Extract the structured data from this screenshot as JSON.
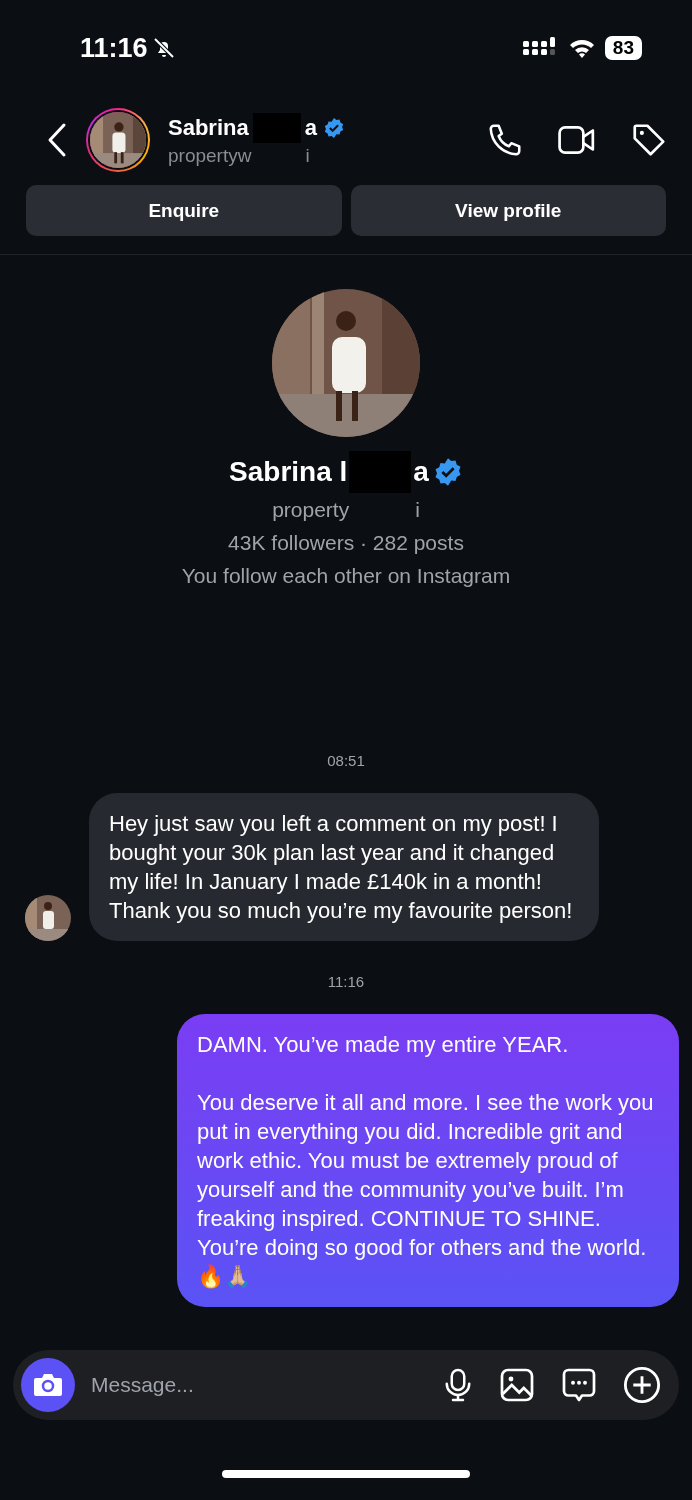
{
  "status_bar": {
    "time": "11:16",
    "silenced": true,
    "battery": "83"
  },
  "header": {
    "name": [
      "Sabrina",
      "a"
    ],
    "handle": [
      "propertyw",
      "i"
    ],
    "verified": true
  },
  "actions": [
    "Enquire",
    "View profile"
  ],
  "profile": {
    "name": [
      "Sabrina l",
      "a"
    ],
    "handle": [
      "property",
      "i"
    ],
    "verified": true,
    "stats": "43K followers · 282 posts",
    "mutual": "You follow each other on Instagram"
  },
  "messages": [
    {
      "kind": "time",
      "text": "08:51"
    },
    {
      "kind": "incoming",
      "paragraphs": [
        "Hey just saw you left a comment on my post! I bought your 30k plan last year and it changed my life! In January I made £140k in a month! Thank you so much you’re my favourite person!"
      ]
    },
    {
      "kind": "time",
      "text": "11:16"
    },
    {
      "kind": "outgoing",
      "paragraphs": [
        "DAMN. You’ve made my entire YEAR.",
        "You deserve it all and more. I see the work you put in everything you did. Incredible grit and work ethic. You must be extremely proud of yourself and the community you’ve built. I’m freaking inspired. CONTINUE TO SHINE. You’re doing so good for others and the world. 🔥🙏🏼"
      ]
    }
  ],
  "composer": {
    "placeholder": "Message..."
  }
}
